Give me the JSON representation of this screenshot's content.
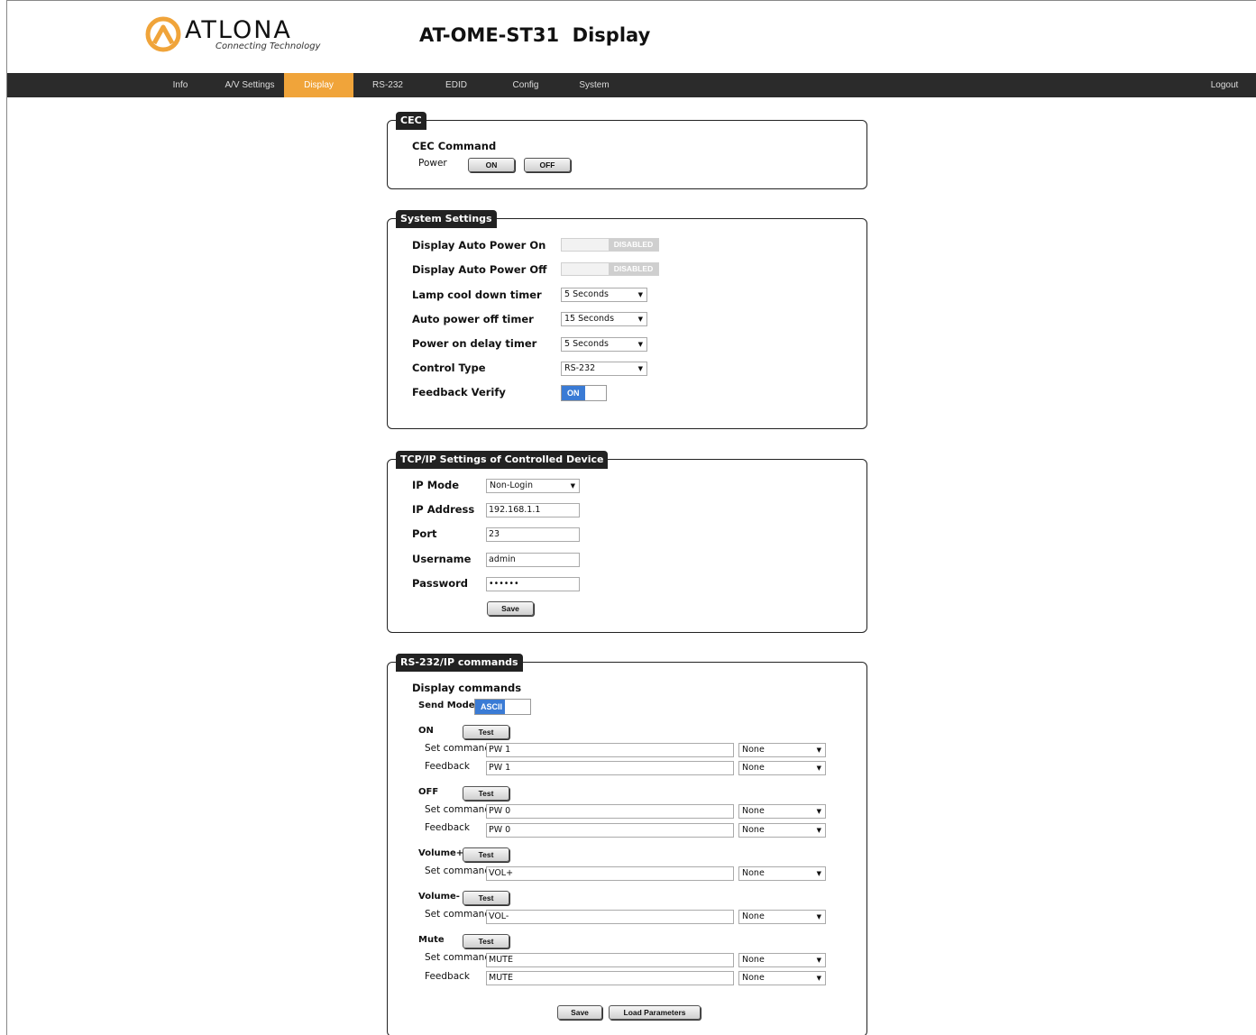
{
  "header": {
    "logo_text": "ATLONA",
    "logo_tagline": "Connecting Technology",
    "title": "AT-OME-ST31  Display"
  },
  "nav": {
    "items": [
      "Info",
      "A/V Settings",
      "Display",
      "RS-232",
      "EDID",
      "Config",
      "System"
    ],
    "active": "Display",
    "logout": "Logout"
  },
  "colors": {
    "accent": "#f0a43a",
    "nav_bg": "#2b2b2b",
    "toggle_on": "#3a7bd5"
  },
  "cec": {
    "legend": "CEC",
    "command_label": "CEC Command",
    "power_label": "Power",
    "on_label": "ON",
    "off_label": "OFF"
  },
  "system": {
    "legend": "System Settings",
    "auto_on_label": "Display Auto Power On",
    "auto_on_value": "DISABLED",
    "auto_off_label": "Display Auto Power Off",
    "auto_off_value": "DISABLED",
    "lamp_label": "Lamp cool down timer",
    "lamp_value": "5 Seconds",
    "auto_power_off_label": "Auto power off timer",
    "auto_power_off_value": "15 Seconds",
    "power_on_delay_label": "Power on delay timer",
    "power_on_delay_value": "5 Seconds",
    "control_type_label": "Control Type",
    "control_type_value": "RS-232",
    "feedback_label": "Feedback Verify",
    "feedback_value": "ON"
  },
  "tcp": {
    "legend": "TCP/IP Settings of Controlled Device",
    "ip_mode_label": "IP Mode",
    "ip_mode_value": "Non-Login",
    "ip_address_label": "IP Address",
    "ip_address_value": "192.168.1.1",
    "port_label": "Port",
    "port_value": "23",
    "username_label": "Username",
    "username_value": "admin",
    "password_label": "Password",
    "password_value": "••••••",
    "save_label": "Save"
  },
  "rs232": {
    "legend": "RS-232/IP commands",
    "display_commands_label": "Display commands",
    "send_mode_label": "Send Mode",
    "send_mode_value": "ASCII",
    "test_label": "Test",
    "set_command_label": "Set command",
    "feedback_label": "Feedback",
    "none_label": "None",
    "on": {
      "label": "ON",
      "set": "PW 1",
      "feedback": "PW 1"
    },
    "off": {
      "label": "OFF",
      "set": "PW 0",
      "feedback": "PW 0"
    },
    "volup": {
      "label": "Volume+",
      "set": "VOL+"
    },
    "voldown": {
      "label": "Volume-",
      "set": "VOL-"
    },
    "mute": {
      "label": "Mute",
      "set": "MUTE",
      "feedback": "MUTE"
    },
    "save_label": "Save",
    "load_label": "Load Parameters"
  }
}
